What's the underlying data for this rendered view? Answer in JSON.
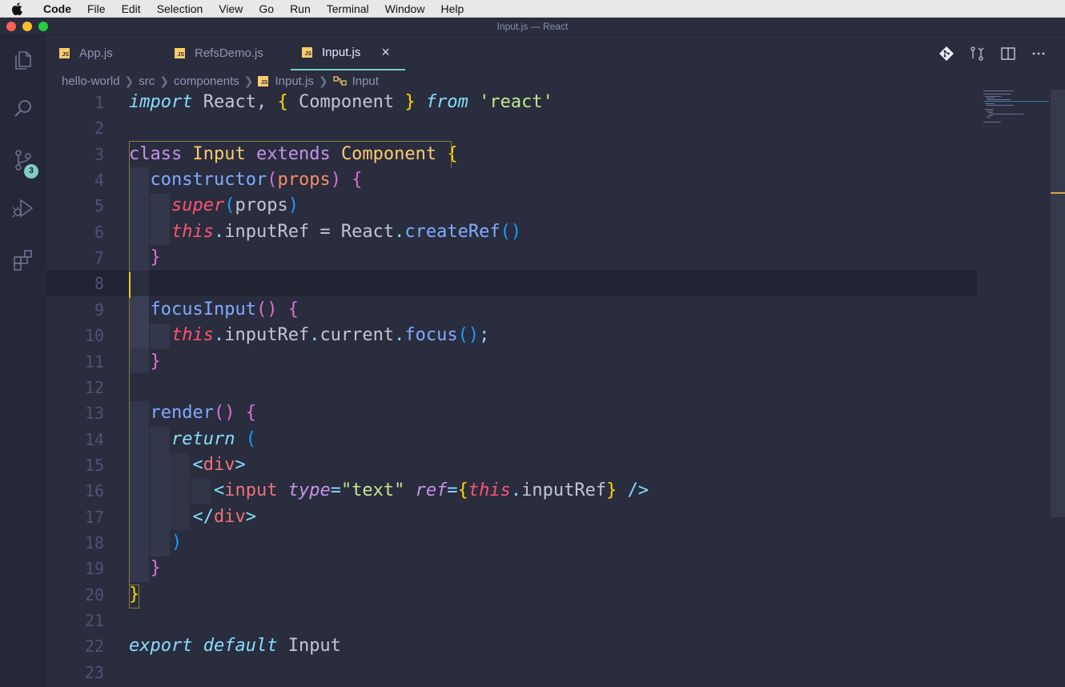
{
  "menubar": {
    "app": "Code",
    "items": [
      "File",
      "Edit",
      "Selection",
      "View",
      "Go",
      "Run",
      "Terminal",
      "Window",
      "Help"
    ]
  },
  "window": {
    "title": "Input.js — React"
  },
  "activity": {
    "scm_badge": "3"
  },
  "tabs": [
    {
      "label": "App.js",
      "icon": "js-file-icon"
    },
    {
      "label": "RefsDemo.js",
      "icon": "js-file-icon"
    },
    {
      "label": "Input.js",
      "icon": "js-file-icon",
      "active": true,
      "close": "×"
    }
  ],
  "breadcrumb": {
    "items": [
      "hello-world",
      "src",
      "components",
      "Input.js",
      "Input"
    ]
  },
  "editor": {
    "line_numbers": [
      "1",
      "2",
      "3",
      "4",
      "5",
      "6",
      "7",
      "8",
      "9",
      "10",
      "11",
      "12",
      "13",
      "14",
      "15",
      "16",
      "17",
      "18",
      "19",
      "20",
      "21",
      "22",
      "23"
    ],
    "current_line": "8",
    "lines": [
      [
        [
          "it",
          "import"
        ],
        [
          "t",
          " React, "
        ],
        [
          "p1",
          "{"
        ],
        [
          "t",
          " Component "
        ],
        [
          "p1",
          "}"
        ],
        [
          "t",
          " "
        ],
        [
          "it",
          "from"
        ],
        [
          "t",
          " "
        ],
        [
          "str",
          "'react'"
        ]
      ],
      [],
      [
        [
          "kw",
          "class"
        ],
        [
          "t",
          " "
        ],
        [
          "cls",
          "Input"
        ],
        [
          "t",
          " "
        ],
        [
          "kw",
          "extends"
        ],
        [
          "t",
          " "
        ],
        [
          "cls",
          "Component"
        ],
        [
          "t",
          " "
        ],
        [
          "p1",
          "{"
        ]
      ],
      [
        [
          "t",
          "  "
        ],
        [
          "fn",
          "constructor"
        ],
        [
          "p2",
          "("
        ],
        [
          "param",
          "props"
        ],
        [
          "p2",
          ")"
        ],
        [
          "t",
          " "
        ],
        [
          "p2",
          "{"
        ]
      ],
      [
        [
          "t",
          "    "
        ],
        [
          "this",
          "super"
        ],
        [
          "p3",
          "("
        ],
        [
          "t",
          "props"
        ],
        [
          "p3",
          ")"
        ]
      ],
      [
        [
          "t",
          "    "
        ],
        [
          "this",
          "this"
        ],
        [
          "pun",
          "."
        ],
        [
          "t",
          "inputRef = React"
        ],
        [
          "pun",
          "."
        ],
        [
          "fn",
          "createRef"
        ],
        [
          "p3",
          "()"
        ]
      ],
      [
        [
          "t",
          "  "
        ],
        [
          "p2",
          "}"
        ]
      ],
      [],
      [
        [
          "t",
          "  "
        ],
        [
          "fn",
          "focusInput"
        ],
        [
          "p2",
          "()"
        ],
        [
          "t",
          " "
        ],
        [
          "p2",
          "{"
        ]
      ],
      [
        [
          "t",
          "    "
        ],
        [
          "this",
          "this"
        ],
        [
          "pun",
          "."
        ],
        [
          "t",
          "inputRef"
        ],
        [
          "pun",
          "."
        ],
        [
          "t",
          "current"
        ],
        [
          "pun",
          "."
        ],
        [
          "fn",
          "focus"
        ],
        [
          "p3",
          "()"
        ],
        [
          "pun",
          ";"
        ]
      ],
      [
        [
          "t",
          "  "
        ],
        [
          "p2",
          "}"
        ]
      ],
      [],
      [
        [
          "t",
          "  "
        ],
        [
          "fn",
          "render"
        ],
        [
          "p2",
          "()"
        ],
        [
          "t",
          " "
        ],
        [
          "p2",
          "{"
        ]
      ],
      [
        [
          "t",
          "    "
        ],
        [
          "it",
          "return"
        ],
        [
          "t",
          " "
        ],
        [
          "p3",
          "("
        ]
      ],
      [
        [
          "t",
          "      "
        ],
        [
          "pun",
          "<"
        ],
        [
          "tag",
          "div"
        ],
        [
          "pun",
          ">"
        ]
      ],
      [
        [
          "t",
          "        "
        ],
        [
          "pun",
          "<"
        ],
        [
          "tag",
          "input"
        ],
        [
          "t",
          " "
        ],
        [
          "attr",
          "type"
        ],
        [
          "pun",
          "="
        ],
        [
          "str",
          "\"text\""
        ],
        [
          "t",
          " "
        ],
        [
          "attr",
          "ref"
        ],
        [
          "pun",
          "="
        ],
        [
          "p1",
          "{"
        ],
        [
          "this",
          "this"
        ],
        [
          "pun",
          "."
        ],
        [
          "t",
          "inputRef"
        ],
        [
          "p1",
          "}"
        ],
        [
          "t",
          " "
        ],
        [
          "pun",
          "/>"
        ]
      ],
      [
        [
          "t",
          "      "
        ],
        [
          "pun",
          "</"
        ],
        [
          "tag",
          "div"
        ],
        [
          "pun",
          ">"
        ]
      ],
      [
        [
          "t",
          "    "
        ],
        [
          "p3",
          ")"
        ]
      ],
      [
        [
          "t",
          "  "
        ],
        [
          "p2",
          "}"
        ]
      ],
      [
        [
          "p1",
          "}"
        ]
      ],
      [],
      [
        [
          "it",
          "export"
        ],
        [
          "t",
          " "
        ],
        [
          "it",
          "default"
        ],
        [
          "t",
          " Input"
        ]
      ],
      []
    ]
  },
  "colors": {
    "editor_bg": "#292d3e",
    "accent": "#80cbc4",
    "keyword": "#c792ea",
    "function": "#82aaff",
    "class": "#ffcb6b",
    "string": "#c3e88d",
    "this": "#ff5370"
  }
}
